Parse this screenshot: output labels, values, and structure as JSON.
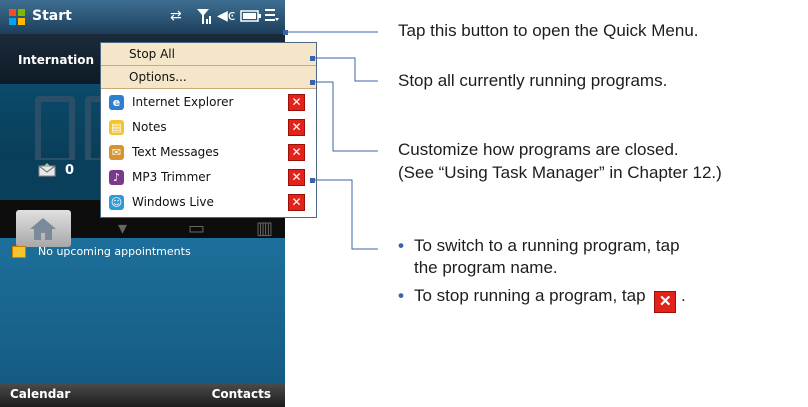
{
  "status_bar": {
    "start_label": "Start"
  },
  "today": {
    "international_label": "Internation",
    "sms_count": "0",
    "appointments_text": "No upcoming appointments"
  },
  "softkeys": {
    "left": "Calendar",
    "right": "Contacts"
  },
  "quick_menu": {
    "stop_all": "Stop All",
    "options": "Options...",
    "programs": [
      {
        "label": "Internet Explorer",
        "icon": "internet-explorer-icon",
        "color": "#2f7fd1",
        "glyph": "e"
      },
      {
        "label": "Notes",
        "icon": "notes-icon",
        "color": "#f3c330",
        "glyph": "▤"
      },
      {
        "label": "Text Messages",
        "icon": "text-messages-icon",
        "color": "#d7932d",
        "glyph": "✉"
      },
      {
        "label": "MP3 Trimmer",
        "icon": "mp3-trimmer-icon",
        "color": "#7a3a8c",
        "glyph": "♪"
      },
      {
        "label": "Windows Live",
        "icon": "windows-live-icon",
        "color": "#2e9bd6",
        "glyph": "☺"
      }
    ]
  },
  "callouts": {
    "quick_menu": "Tap this button to open the Quick Menu.",
    "stop_all": "Stop all currently running programs.",
    "options_line1": "Customize how programs are closed.",
    "options_line2": "(See “Using Task Manager” in Chapter 12.)",
    "bullet1_line1": "To switch to a running program, tap",
    "bullet1_line2": "the program name.",
    "bullet2": "To stop running a program, tap",
    "bullet2_end": "."
  },
  "colors": {
    "close_button": "#e2231a",
    "callout_line": "#3b63a8"
  }
}
